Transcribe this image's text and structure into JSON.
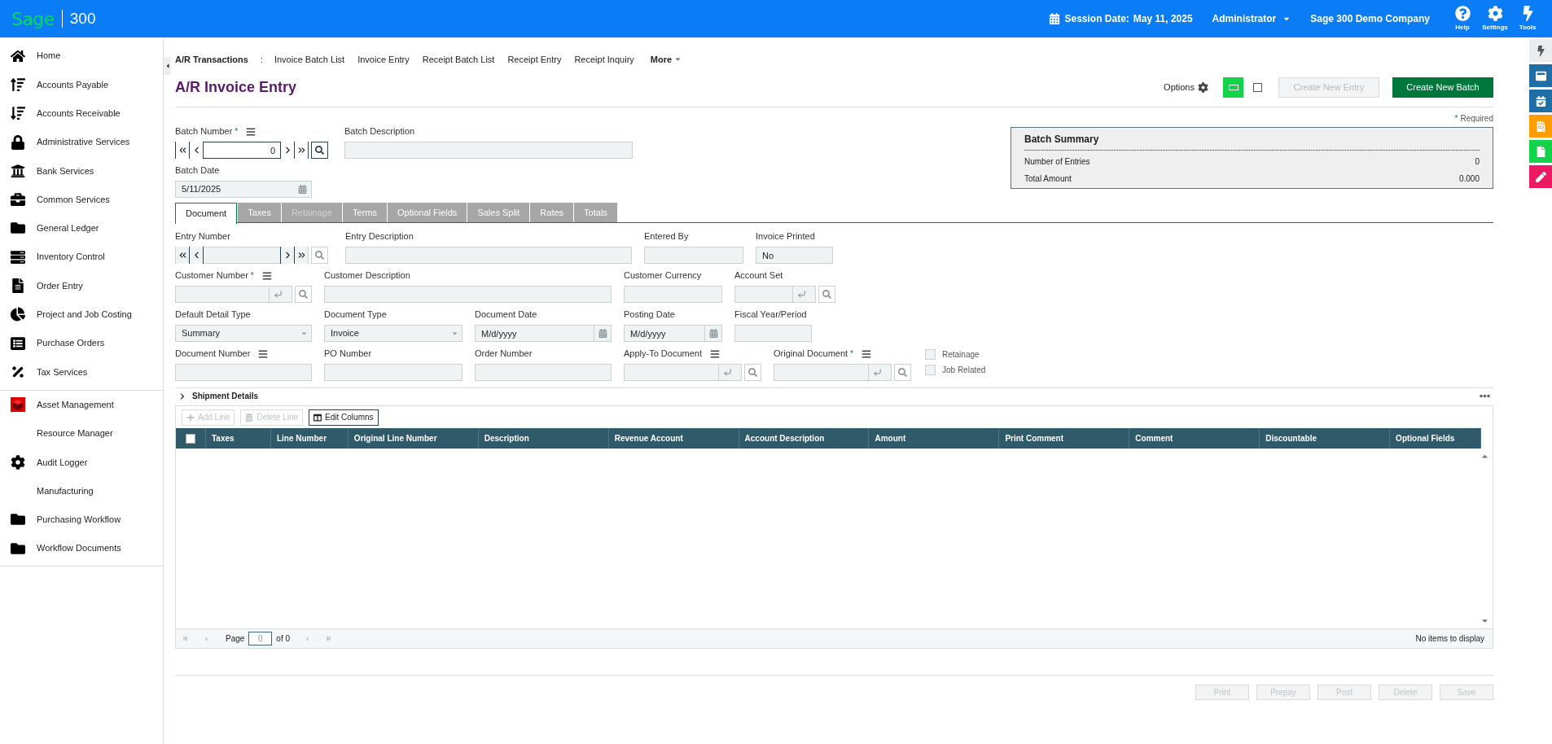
{
  "top_bar": {
    "brand": "Sage",
    "product": "300",
    "session_label": "Session Date:",
    "session_date": "May 11, 2025",
    "user": "Administrator",
    "company": "Sage 300 Demo Company",
    "tools": [
      {
        "label": "Help"
      },
      {
        "label": "Settings"
      },
      {
        "label": "Tools"
      }
    ]
  },
  "sidebar": {
    "groups": [
      {
        "items": [
          "Home",
          "Accounts Payable",
          "Accounts Receivable",
          "Administrative Services",
          "Bank Services",
          "Common Services",
          "General Ledger",
          "Inventory Control",
          "Order Entry",
          "Project and Job Costing",
          "Purchase Orders",
          "Tax Services"
        ]
      },
      {
        "items": [
          "Asset Management",
          "Resource Manager",
          "Audit Logger",
          "Manufacturing",
          "Purchasing Workflow",
          "Workflow Documents"
        ]
      }
    ]
  },
  "breadcrumb": {
    "section": "A/R Transactions",
    "separator": ":",
    "links": [
      "Invoice Batch List",
      "Invoice Entry",
      "Receipt Batch List",
      "Receipt Entry",
      "Receipt Inquiry"
    ],
    "more": "More"
  },
  "page": {
    "title": "A/R Invoice Entry",
    "options": "Options",
    "view_checkbox": {
      "checked": false
    },
    "actions": [
      {
        "label": "Create New Entry",
        "disabled": true
      },
      {
        "label": "Create New Batch",
        "disabled": false
      }
    ]
  },
  "required_mark": "*",
  "required_note": "Required",
  "batch": {
    "number": {
      "label": "Batch Number",
      "required": true,
      "menu": true,
      "value": "0"
    },
    "description": {
      "label": "Batch Description"
    },
    "date": {
      "label": "Batch Date",
      "value": "5/11/2025"
    }
  },
  "batch_summary": {
    "title": "Batch Summary",
    "rows": [
      {
        "label": "Number of Entries",
        "value": "0"
      },
      {
        "label": "Total Amount",
        "value": "0.000"
      }
    ]
  },
  "tabs": [
    {
      "label": "Document",
      "selected": true,
      "disabled": false
    },
    {
      "label": "Taxes",
      "selected": false,
      "disabled": false
    },
    {
      "label": "Retainage",
      "selected": false,
      "disabled": true
    },
    {
      "label": "Terms",
      "selected": false,
      "disabled": false
    },
    {
      "label": "Optional Fields",
      "selected": false,
      "disabled": false
    },
    {
      "label": "Sales Split",
      "selected": false,
      "disabled": false
    },
    {
      "label": "Rates",
      "selected": false,
      "disabled": false
    },
    {
      "label": "Totals",
      "selected": false,
      "disabled": false
    }
  ],
  "form_rows": [
    [
      {
        "kind": "nav",
        "label": "Entry Number",
        "required": false,
        "menu": false
      },
      {
        "kind": "text",
        "label": "Entry Description",
        "required": false,
        "menu": false
      },
      {
        "kind": "text",
        "label": "Entered By",
        "required": false,
        "menu": false
      },
      {
        "kind": "text",
        "label": "Invoice Printed",
        "required": false,
        "menu": false,
        "value": "No"
      }
    ],
    [
      {
        "kind": "lookup",
        "label": "Customer Number",
        "required": true,
        "menu": true
      },
      {
        "kind": "text",
        "label": "Customer Description",
        "required": false,
        "menu": false
      },
      {
        "kind": "text",
        "label": "Customer Currency",
        "required": false,
        "menu": false
      },
      {
        "kind": "lookup",
        "label": "Account Set",
        "required": false,
        "menu": false
      }
    ],
    [
      {
        "kind": "select",
        "label": "Default Detail Type",
        "required": false,
        "menu": false,
        "value": "Summary"
      },
      {
        "kind": "select",
        "label": "Document Type",
        "required": false,
        "menu": false,
        "value": "Invoice"
      },
      {
        "kind": "date",
        "label": "Document Date",
        "required": false,
        "menu": false,
        "placeholder": "M/d/yyyy"
      },
      {
        "kind": "date",
        "label": "Posting Date",
        "required": false,
        "menu": false,
        "placeholder": "M/d/yyyy"
      },
      {
        "kind": "text",
        "label": "Fiscal Year/Period",
        "required": false,
        "menu": false
      }
    ],
    [
      {
        "kind": "text",
        "label": "Document Number",
        "required": false,
        "menu": true
      },
      {
        "kind": "text",
        "label": "PO Number",
        "required": false,
        "menu": false
      },
      {
        "kind": "text",
        "label": "Order Number",
        "required": false,
        "menu": false
      },
      {
        "kind": "lookup",
        "label": "Apply-To Document",
        "required": false,
        "menu": true
      },
      {
        "kind": "lookup",
        "label": "Original Document",
        "required": true,
        "menu": true
      }
    ]
  ],
  "checkboxes": [
    {
      "label": "Retainage",
      "checked": false
    },
    {
      "label": "Job Related",
      "checked": false
    }
  ],
  "shipment": {
    "label": "Shipment Details",
    "expanded": false
  },
  "grid": {
    "toolbar": [
      {
        "kind": "add",
        "label": "Add Line",
        "disabled": true
      },
      {
        "kind": "delete",
        "label": "Delete Line",
        "disabled": true
      },
      {
        "kind": "columns",
        "label": "Edit Columns",
        "disabled": false
      }
    ],
    "header_checkbox": {
      "checked": false
    },
    "columns": [
      "Taxes",
      "Line Number",
      "Original Line Number",
      "Description",
      "Revenue Account",
      "Account Description",
      "Amount",
      "Print Comment",
      "Comment",
      "Discountable",
      "Optional Fields"
    ],
    "pager": {
      "label": "Page",
      "placeholder": "0",
      "of": "of 0",
      "status": "No items to display"
    }
  },
  "footer_buttons": [
    {
      "label": "Print",
      "disabled": true
    },
    {
      "label": "Prepay",
      "disabled": true
    },
    {
      "label": "Post",
      "disabled": true
    },
    {
      "label": "Delete",
      "disabled": true
    },
    {
      "label": "Save",
      "disabled": true
    }
  ]
}
